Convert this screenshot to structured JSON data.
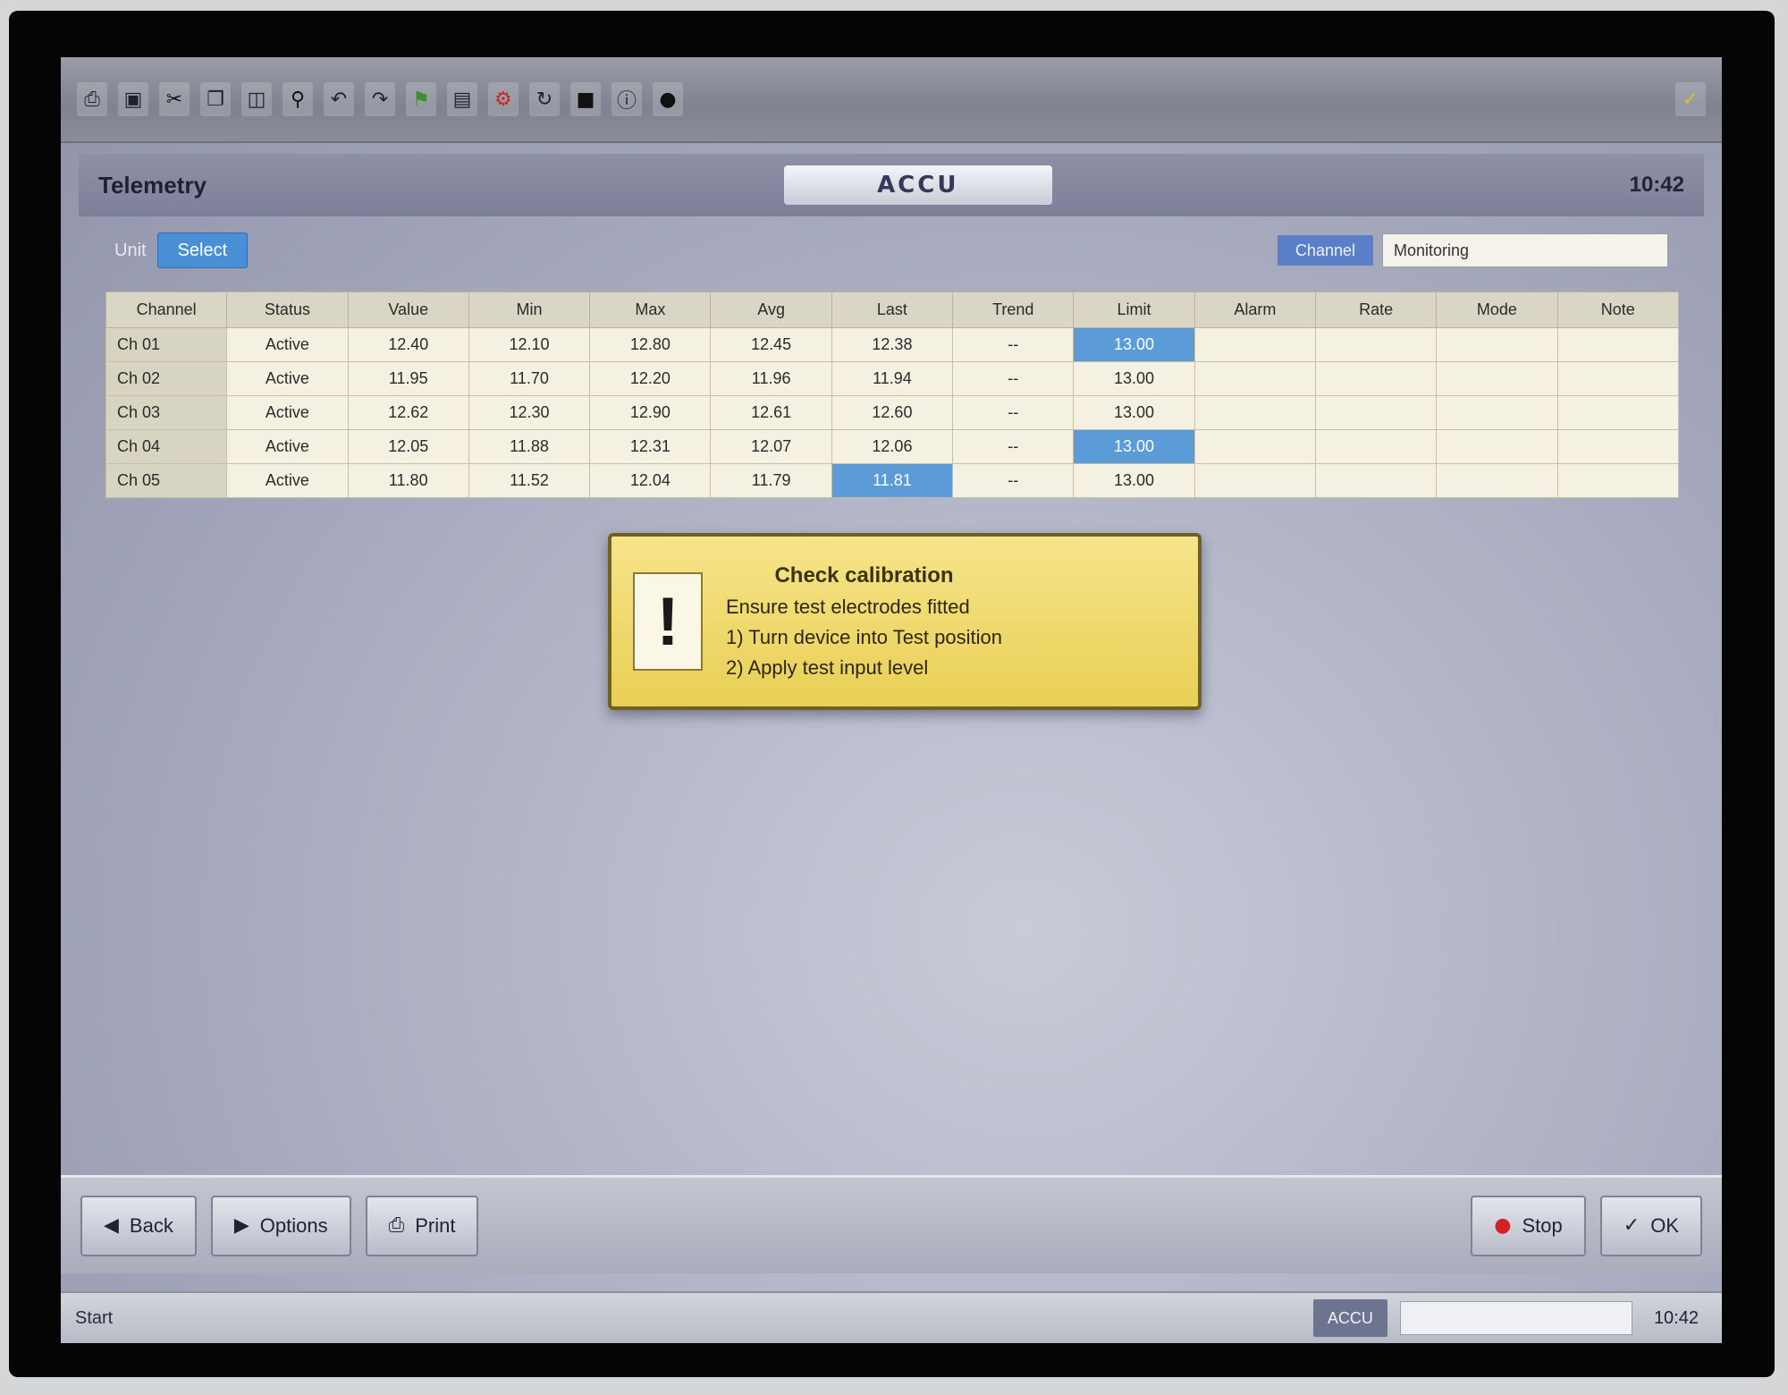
{
  "toolbar": {
    "icons": [
      "print-icon",
      "save-icon",
      "cut-icon",
      "copy-icon",
      "paste-icon",
      "find-icon",
      "undo-icon",
      "redo-icon",
      "flag-icon",
      "chart-icon",
      "settings-icon",
      "refresh-icon",
      "stop-icon",
      "info-icon",
      "lock-icon"
    ]
  },
  "header": {
    "app_name": "Telemetry",
    "logo_text": "ACCU",
    "clock": "10:42"
  },
  "controls": {
    "unit_label": "Unit",
    "unit_button": "Select",
    "filter_tag": "Channel",
    "filter_value": "Monitoring"
  },
  "grid": {
    "columns": [
      "Channel",
      "Status",
      "Value",
      "Min",
      "Max",
      "Avg",
      "Last",
      "Trend",
      "Limit",
      "Alarm",
      "Rate",
      "Mode",
      "Note"
    ],
    "rows": [
      [
        "Ch 01",
        "Active",
        "12.40",
        "12.10",
        "12.80",
        "12.45",
        "12.38",
        "--",
        "13.00",
        "",
        "",
        "",
        ""
      ],
      [
        "Ch 02",
        "Active",
        "11.95",
        "11.70",
        "12.20",
        "11.96",
        "11.94",
        "--",
        "13.00",
        "",
        "",
        "",
        ""
      ],
      [
        "Ch 03",
        "Active",
        "12.62",
        "12.30",
        "12.90",
        "12.61",
        "12.60",
        "--",
        "13.00",
        "",
        "",
        "",
        ""
      ],
      [
        "Ch 04",
        "Active",
        "12.05",
        "11.88",
        "12.31",
        "12.07",
        "12.06",
        "--",
        "13.00",
        "",
        "",
        "",
        ""
      ],
      [
        "Ch 05",
        "Active",
        "11.80",
        "11.52",
        "12.04",
        "11.79",
        "11.81",
        "--",
        "13.00",
        "",
        "",
        "",
        ""
      ]
    ],
    "selected": [
      [
        0,
        8
      ],
      [
        3,
        8
      ],
      [
        4,
        6
      ]
    ]
  },
  "notice": {
    "icon_glyph": "!",
    "title": "Check calibration",
    "line1": "Ensure test electrodes fitted",
    "line2": "1) Turn device into Test position",
    "line3": "2) Apply test input level"
  },
  "bottom": {
    "btn_back": "Back",
    "btn_options": "Options",
    "btn_print": "Print",
    "hint": "",
    "btn_stop": "Stop",
    "btn_ok": "OK"
  },
  "taskbar": {
    "start": "Start",
    "item": "ACCU",
    "clock": "10:42"
  },
  "colors": {
    "selection": "#5b9bd8",
    "notice_bg": "#f6e48a",
    "stop_icon": "#d32121"
  }
}
